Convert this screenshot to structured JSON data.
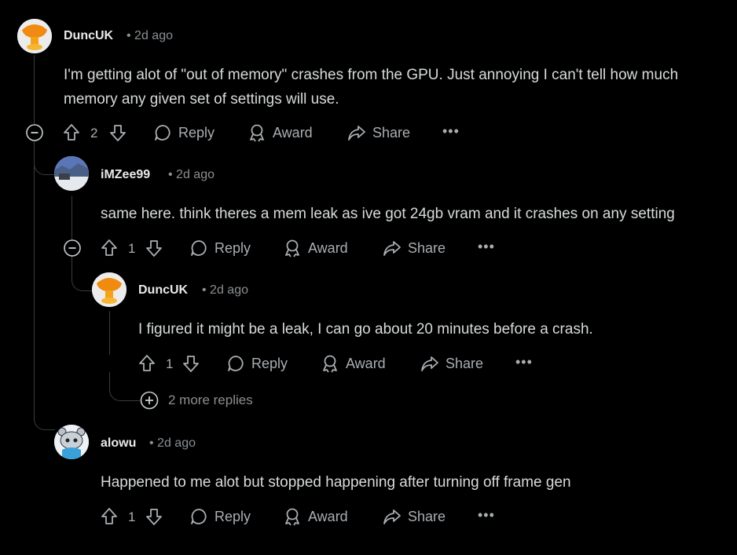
{
  "comments": [
    {
      "username": "DuncUK",
      "time": "• 2d ago",
      "body": "I'm getting alot of \"out of memory\" crashes from the GPU. Just annoying I can't tell how much memory any given set of settings will use.",
      "votes": "2",
      "avatar_icon": "orange-mushroom-avatar"
    },
    {
      "username": "iMZee99",
      "time": "• 2d ago",
      "body": "same here. think theres a mem leak as ive got 24gb vram and it crashes on any setting",
      "votes": "1",
      "avatar_icon": "landscape-photo-avatar"
    },
    {
      "username": "DuncUK",
      "time": "• 2d ago",
      "body": "I figured it might be a leak, I can go about 20 minutes before a crash.",
      "votes": "1",
      "avatar_icon": "orange-mushroom-avatar"
    },
    {
      "username": "alowu",
      "time": "• 2d ago",
      "body": "Happened to me alot but stopped happening after turning off frame gen",
      "votes": "1",
      "avatar_icon": "snoo-avatar"
    }
  ],
  "actions": {
    "reply": "Reply",
    "award": "Award",
    "share": "Share",
    "more": "•••"
  },
  "more_replies": "2 more replies",
  "colors": {
    "background": "#000000",
    "text": "#d7dadc",
    "muted": "#8a8f93",
    "thread_line": "#3a3c3e"
  }
}
